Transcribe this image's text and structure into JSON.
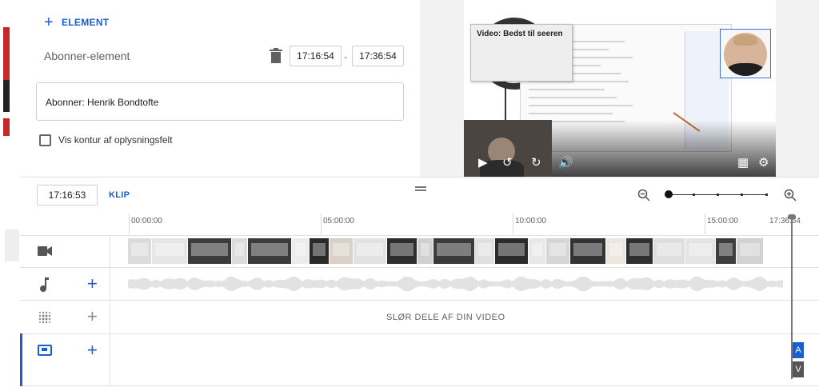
{
  "editor": {
    "add_element_label": "ELEMENT",
    "element_name": "Abonner-element",
    "start_time": "17:16:54",
    "end_time": "17:36:54",
    "time_separator": "-",
    "text_value": "Abonner: Henrik Bondtofte",
    "outline_checkbox_label": "Vis kontur af oplysningsfelt",
    "outline_checked": false
  },
  "preview": {
    "video_card_title": "Video: Bedst til seeren",
    "accent_color": "#3d6fd6"
  },
  "toolbar": {
    "current_time": "17:16:53",
    "clip_label": "KLIP",
    "zoom_level_fraction": 0.0
  },
  "timeline": {
    "ruler_labels": [
      "00:00:00",
      "05:00:00",
      "10:00:00",
      "15:00:00",
      "17:36:54"
    ],
    "tracks": [
      {
        "name": "video",
        "icon": "video-camera-icon",
        "has_add": false
      },
      {
        "name": "audio",
        "icon": "music-note-icon",
        "has_add": true
      },
      {
        "name": "blur",
        "icon": "blur-icon",
        "has_add": true,
        "label": "SLØR DELE AF DIN VIDEO"
      },
      {
        "name": "elements",
        "icon": "end-screen-icon",
        "has_add": true
      }
    ],
    "chips": [
      "A",
      "V"
    ],
    "accent_color": "#1a5fd0"
  }
}
